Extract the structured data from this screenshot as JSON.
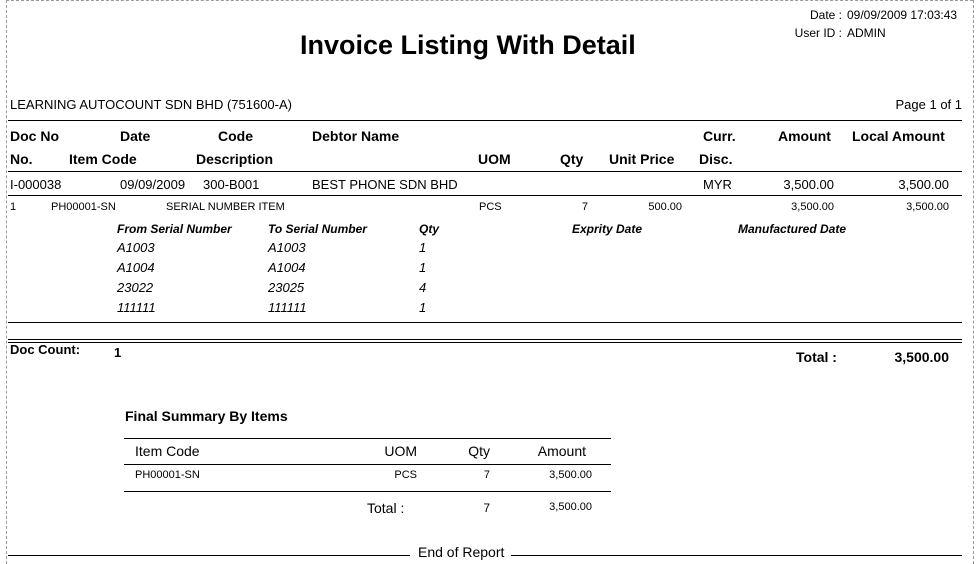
{
  "report": {
    "date_label": "Date :",
    "date_value": "09/09/2009 17:03:43",
    "userid_label": "User ID :",
    "userid_value": "ADMIN",
    "title": "Invoice Listing With Detail",
    "company": "LEARNING AUTOCOUNT SDN BHD (751600-A)",
    "page": "Page 1 of 1"
  },
  "header": {
    "row1": {
      "doc_no": "Doc No",
      "date": "Date",
      "code": "Code",
      "debtor_name": "Debtor Name",
      "curr": "Curr.",
      "amount": "Amount",
      "local_amount": "Local Amount"
    },
    "row2": {
      "no": "No.",
      "item_code": "Item Code",
      "description": "Description",
      "uom": "UOM",
      "qty": "Qty",
      "unit_price": "Unit Price",
      "disc": "Disc."
    }
  },
  "invoice": {
    "doc_no": "I-000038",
    "date": "09/09/2009",
    "code": "300-B001",
    "debtor_name": "BEST PHONE SDN BHD",
    "curr": "MYR",
    "amount": "3,500.00",
    "local_amount": "3,500.00"
  },
  "item": {
    "no": "1",
    "item_code": "PH00001-SN",
    "description": "SERIAL NUMBER ITEM",
    "uom": "PCS",
    "qty": "7",
    "unit_price": "500.00",
    "amount": "3,500.00",
    "local_amount": "3,500.00"
  },
  "serial_header": {
    "from": "From Serial Number",
    "to": "To Serial Number",
    "qty": "Qty",
    "expiry": "Exprity Date",
    "manufactured": "Manufactured Date"
  },
  "serials": [
    {
      "from": "A1003",
      "to": "A1003",
      "qty": "1"
    },
    {
      "from": "A1004",
      "to": "A1004",
      "qty": "1"
    },
    {
      "from": "23022",
      "to": "23025",
      "qty": "4"
    },
    {
      "from": "111111",
      "to": "111111",
      "qty": "1"
    }
  ],
  "footer": {
    "doc_count_label": "Doc Count:",
    "doc_count_value": "1",
    "total_label": "Total :",
    "total_value": "3,500.00"
  },
  "summary": {
    "title": "Final Summary By Items",
    "headers": {
      "item_code": "Item Code",
      "uom": "UOM",
      "qty": "Qty",
      "amount": "Amount"
    },
    "rows": [
      {
        "item_code": "PH00001-SN",
        "uom": "PCS",
        "qty": "7",
        "amount": "3,500.00"
      }
    ],
    "total_label": "Total :",
    "total_qty": "7",
    "total_amount": "3,500.00"
  },
  "end_text": "End of Report"
}
